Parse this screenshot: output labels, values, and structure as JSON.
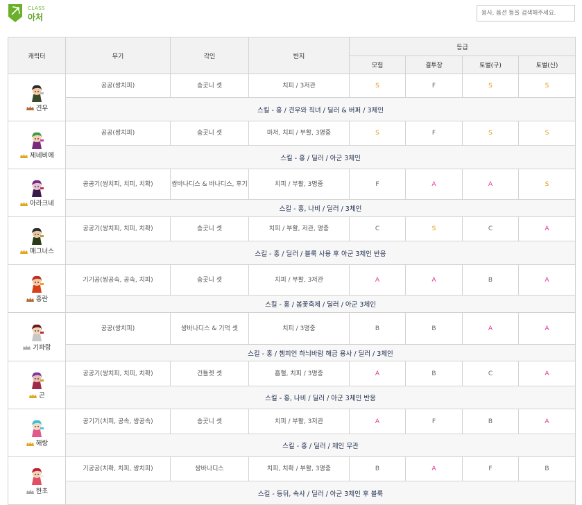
{
  "header": {
    "class_small": "CLASS",
    "class_name": "아처",
    "search_placeholder": "용사, 옵션 등을 검색해주세요."
  },
  "table": {
    "col_character": "캐릭터",
    "col_weapon": "무기",
    "col_engrave": "각인",
    "col_ring": "반지",
    "col_grade": "등급",
    "grade_cols": [
      "모험",
      "결투장",
      "토벌(구)",
      "토벌(신)"
    ]
  },
  "colors": {
    "S": "#e29a22",
    "A": "#e0398f",
    "other": "#666666",
    "accent_green": "#5ea121"
  },
  "rows": [
    {
      "name": "견우",
      "icon": "rank-bronze-icon",
      "weapon": "공공(쌍치피)",
      "engrave": "송곳니 셋",
      "ring": "치피 / 3저관",
      "grades": [
        "S",
        "F",
        "S",
        "S"
      ],
      "skill": "스킬 - 홍 / 견우와 직녀 / 딜러 & 버퍼 / 3체인",
      "skin": "#f3c9a1",
      "hair": "#2b2b2b",
      "cloth": "#3a4a2a",
      "acc": "#b9b9b9"
    },
    {
      "name": "제네비에",
      "icon": "rank-gold-icon",
      "weapon": "공공(쌍치피)",
      "engrave": "송곳니 셋",
      "ring": "마저, 치피 / 부활, 3명중",
      "grades": [
        "S",
        "F",
        "S",
        "S"
      ],
      "skill": "스킬 - 홍 / 딜러 / 아군 3체인",
      "skin": "#f3d0b0",
      "hair": "#3f9a4a",
      "cloth": "#7a2a7a",
      "acc": "#d33aa0"
    },
    {
      "name": "아라크네",
      "icon": "rank-gold-icon",
      "weapon": "공공기(쌍치피, 치피, 치확)",
      "engrave": "쌍바나디스 & 바나디스, 후기",
      "ring": "치피 / 부활, 3명중",
      "grades": [
        "F",
        "A",
        "A",
        "S"
      ],
      "skill": "스킬 - 홍, 나비 / 딜러 / 3체인",
      "skin": "#e8c0d0",
      "hair": "#6a2a8a",
      "cloth": "#3a1a4a",
      "acc": "#c0304a"
    },
    {
      "name": "매그너스",
      "icon": "rank-gold-icon",
      "weapon": "공공기(쌍치피, 치피, 치확)",
      "engrave": "송곳니 셋",
      "ring": "치피 / 부활, 저관, 명중",
      "grades": [
        "C",
        "S",
        "C",
        "A"
      ],
      "skill": "스킬 - 홍 / 딜러 / 블룩 사용 후 아군 3체인 반응",
      "skin": "#e9c8a0",
      "hair": "#2a2a2a",
      "cloth": "#2a3a1a",
      "acc": "#b8a040"
    },
    {
      "name": "홍란",
      "icon": "rank-bronze-icon",
      "weapon": "기기공(쌍공속, 공속, 치피)",
      "engrave": "송곳니 셋",
      "ring": "치피 / 부활, 3저관",
      "grades": [
        "A",
        "A",
        "B",
        "A"
      ],
      "skill": "스킬 - 홍 / 봄꽃축제 / 딜러 / 아군 3체인",
      "skin": "#f3caa5",
      "hair": "#c23020",
      "cloth": "#d8401a",
      "acc": "#f0a020"
    },
    {
      "name": "기파랑",
      "icon": "rank-silver-icon",
      "weapon": "공공(쌍치피)",
      "engrave": "쌍바나디스 & 기억 셋",
      "ring": "치피 / 3명중",
      "grades": [
        "B",
        "B",
        "A",
        "A"
      ],
      "skill": "스킬 - 홍 / 챔피언 하늬바람 해금 용사 / 딜러 / 3체인",
      "skin": "#f3d4b8",
      "hair": "#6a1a1a",
      "cloth": "#c8c8c8",
      "acc": "#c02a2a"
    },
    {
      "name": "곤",
      "icon": "rank-gold-icon",
      "weapon": "공공기(쌍치피, 치피, 치확)",
      "engrave": "건틀렛 셋",
      "ring": "흡혈, 치피 / 3명중",
      "grades": [
        "A",
        "B",
        "C",
        "A"
      ],
      "skill": "스킬 - 홍, 나비 / 딜러 / 아군 3체인 반응",
      "skin": "#e8c0b0",
      "hair": "#7a3aa0",
      "cloth": "#a02a4a",
      "acc": "#d0a030"
    },
    {
      "name": "해랑",
      "icon": "rank-gold-icon",
      "weapon": "공기기(치피, 공속, 쌍공속)",
      "engrave": "송곳니 셋",
      "ring": "치피 / 부활, 3저관",
      "grades": [
        "A",
        "F",
        "B",
        "A"
      ],
      "skill": "스킬 - 홍 / 딜러 / 체인 무관",
      "skin": "#f5d8c5",
      "hair": "#3ac0d0",
      "cloth": "#e05a8a",
      "acc": "#50c0e0"
    },
    {
      "name": "한초",
      "icon": "rank-silver-icon",
      "weapon": "기공공(치확, 치피, 쌍치피)",
      "engrave": "쌍바나디스",
      "ring": "치피, 치확 / 부활, 3명중",
      "grades": [
        "B",
        "A",
        "F",
        "B"
      ],
      "skill": "스킬 - 등뒤, 속사 / 딜러 / 아군 3체인 후 블룩",
      "skin": "#f3d0b8",
      "hair": "#c02030",
      "cloth": "#e05060",
      "acc": "#f0f0f0"
    }
  ]
}
